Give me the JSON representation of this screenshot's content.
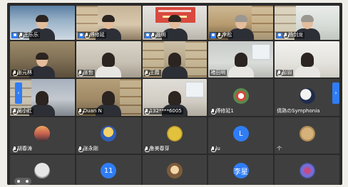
{
  "meeting": {
    "tiles": [
      {
        "name": "王乐乐",
        "host": true,
        "mic": false,
        "kind": "camera",
        "cam": "cam-1",
        "hair": "short",
        "body": "dark"
      },
      {
        "name": "傅修延",
        "host": true,
        "mic": false,
        "kind": "camera",
        "cam": "cam-2",
        "hair": "short",
        "body": "dark"
      },
      {
        "name": "聂明",
        "host": true,
        "mic": false,
        "kind": "camera",
        "cam": "cam-3",
        "hair": "short",
        "body": "dark",
        "banner": true
      },
      {
        "name": "李松",
        "host": true,
        "mic": false,
        "kind": "camera",
        "cam": "cam-4",
        "hair": "grey",
        "body": "dark"
      },
      {
        "name": "杨剑龙",
        "host": true,
        "mic": false,
        "kind": "camera",
        "cam": "cam-5",
        "hair": "grey",
        "body": "dark"
      },
      {
        "name": "张元林",
        "host": false,
        "mic": true,
        "kind": "camera",
        "cam": "cam-6",
        "hair": "short",
        "body": "dark"
      },
      {
        "name": "张哲",
        "host": false,
        "mic": true,
        "kind": "camera",
        "cam": "cam-7",
        "hair": "long",
        "body": "light"
      },
      {
        "name": "王霞",
        "host": false,
        "mic": true,
        "kind": "camera",
        "cam": "cam-8",
        "hair": "long",
        "body": "dark"
      },
      {
        "name": "褚田明",
        "host": false,
        "mic": false,
        "kind": "camera",
        "cam": "cam-9",
        "hair": "long",
        "body": "light"
      },
      {
        "name": "彭羽",
        "host": false,
        "mic": true,
        "kind": "camera",
        "cam": "cam-10",
        "hair": "long",
        "body": "light"
      },
      {
        "name": "吴小红",
        "host": false,
        "mic": true,
        "kind": "camera",
        "cam": "cam-11",
        "hair": "long",
        "body": "dark"
      },
      {
        "name": "Duan N",
        "host": false,
        "mic": true,
        "kind": "camera",
        "cam": "cam-12",
        "hair": "long",
        "body": "dark"
      },
      {
        "name": "132****6005",
        "host": false,
        "mic": true,
        "kind": "camera",
        "cam": "cam-13",
        "hair": "long",
        "body": "dark"
      },
      {
        "name": "傅修延1",
        "host": false,
        "mic": true,
        "kind": "avatar",
        "avatar": "rose",
        "text": ""
      },
      {
        "name": "倩熟のSymphonia",
        "host": false,
        "mic": false,
        "kind": "avatar",
        "avatar": "moon",
        "text": ""
      },
      {
        "name": "胡春涛",
        "host": false,
        "mic": true,
        "kind": "avatar",
        "avatar": "sunset",
        "text": ""
      },
      {
        "name": "张永刚",
        "host": false,
        "mic": true,
        "kind": "avatar",
        "avatar": "cartoon",
        "text": ""
      },
      {
        "name": "鲁美春芽",
        "host": false,
        "mic": true,
        "kind": "avatar",
        "avatar": "smiley",
        "text": ""
      },
      {
        "name": "lu",
        "host": false,
        "mic": true,
        "kind": "avatar",
        "avatar": "blue",
        "text": "L"
      },
      {
        "name": "个",
        "host": false,
        "mic": false,
        "kind": "avatar",
        "avatar": "beige",
        "text": ""
      },
      {
        "name": "",
        "host": false,
        "mic": false,
        "kind": "avatar",
        "avatar": "grey",
        "text": "",
        "toolbar": true
      },
      {
        "name": "",
        "host": false,
        "mic": false,
        "kind": "avatar",
        "avatar": "blue",
        "text": "11"
      },
      {
        "name": "",
        "host": false,
        "mic": false,
        "kind": "avatar",
        "avatar": "cat",
        "text": ""
      },
      {
        "name": "",
        "host": false,
        "mic": false,
        "kind": "avatar",
        "avatar": "blue",
        "text": "李星"
      },
      {
        "name": "",
        "host": false,
        "mic": false,
        "kind": "avatar",
        "avatar": "pinkflower",
        "text": ""
      }
    ],
    "nav": {
      "prev_glyph": "‹",
      "next_glyph": "›"
    }
  }
}
